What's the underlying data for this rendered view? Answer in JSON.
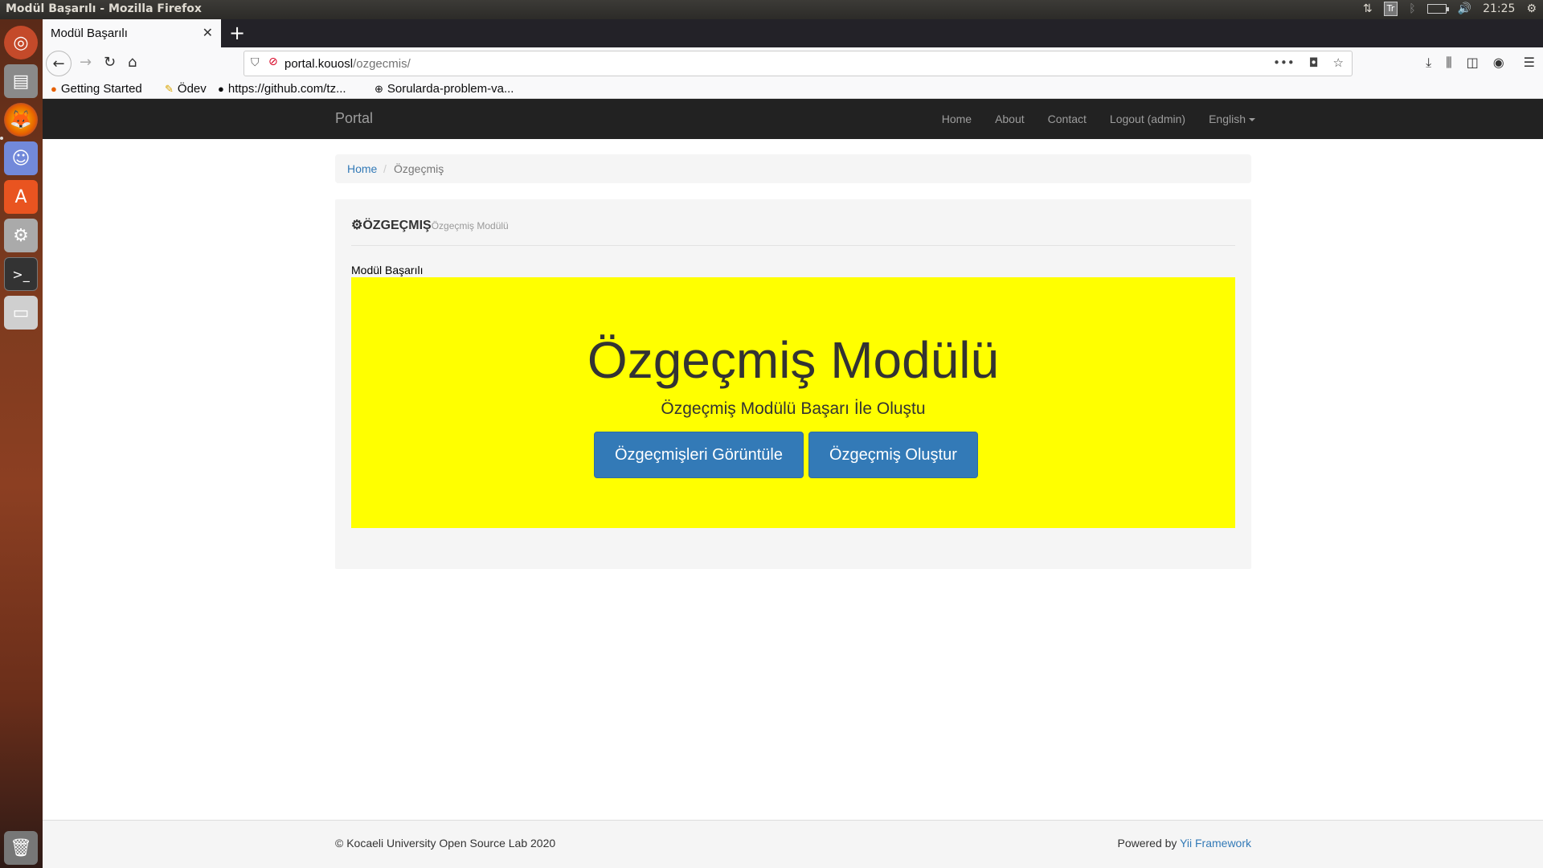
{
  "os": {
    "window_title": "Modül Başarılı - Mozilla Firefox",
    "tray": {
      "keyboard_layout": "Tr",
      "clock": "21:25"
    }
  },
  "browser": {
    "tab_title": "Modül Başarılı",
    "url_host": "portal.kouosl",
    "url_path": "/ozgecmis/",
    "bookmarks": [
      "Getting Started",
      "Ödev",
      "https://github.com/tz...",
      "Sorularda-problem-va..."
    ]
  },
  "site": {
    "brand": "Portal",
    "nav": {
      "home": "Home",
      "about": "About",
      "contact": "Contact",
      "logout": "Logout (admin)",
      "language": "English"
    },
    "breadcrumb": {
      "home": "Home",
      "separator": "/",
      "current": "Özgeçmiş"
    },
    "panel": {
      "title": "ÖZGEÇMIŞ",
      "subtitle": "Özgeçmiş Modülü",
      "message": "Modül Başarılı",
      "jumbotron": {
        "heading": "Özgeçmiş Modülü",
        "lead": "Özgeçmiş Modülü Başarı İle Oluştu",
        "view_button": "Özgeçmişleri Görüntüle",
        "create_button": "Özgeçmiş Oluştur",
        "background": "#ffff00"
      }
    },
    "footer": {
      "copyright": "© Kocaeli University Open Source Lab 2020",
      "powered_by": "Powered by",
      "framework_link": "Yii Framework"
    },
    "colors": {
      "navbar": "#222222",
      "link": "#337ab7",
      "button": "#337ab7"
    }
  }
}
